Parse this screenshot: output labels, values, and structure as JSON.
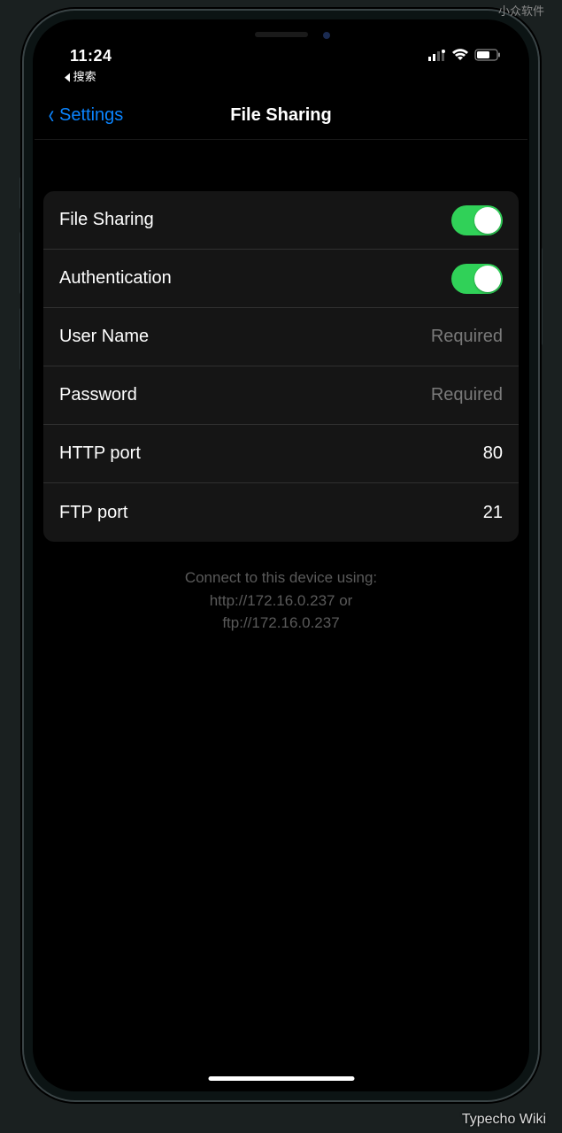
{
  "watermarks": {
    "top": "小众软件",
    "bottom": "Typecho Wiki"
  },
  "status": {
    "time": "11:24",
    "breadcrumb": "搜索"
  },
  "nav": {
    "back_label": "Settings",
    "title": "File Sharing"
  },
  "rows": {
    "file_sharing": {
      "label": "File Sharing",
      "on": true
    },
    "authentication": {
      "label": "Authentication",
      "on": true
    },
    "username": {
      "label": "User Name",
      "placeholder": "Required"
    },
    "password": {
      "label": "Password",
      "placeholder": "Required"
    },
    "http_port": {
      "label": "HTTP port",
      "value": "80"
    },
    "ftp_port": {
      "label": "FTP port",
      "value": "21"
    }
  },
  "footer": {
    "line1": "Connect to this device using:",
    "line2": "http://172.16.0.237 or",
    "line3": "ftp://172.16.0.237"
  }
}
